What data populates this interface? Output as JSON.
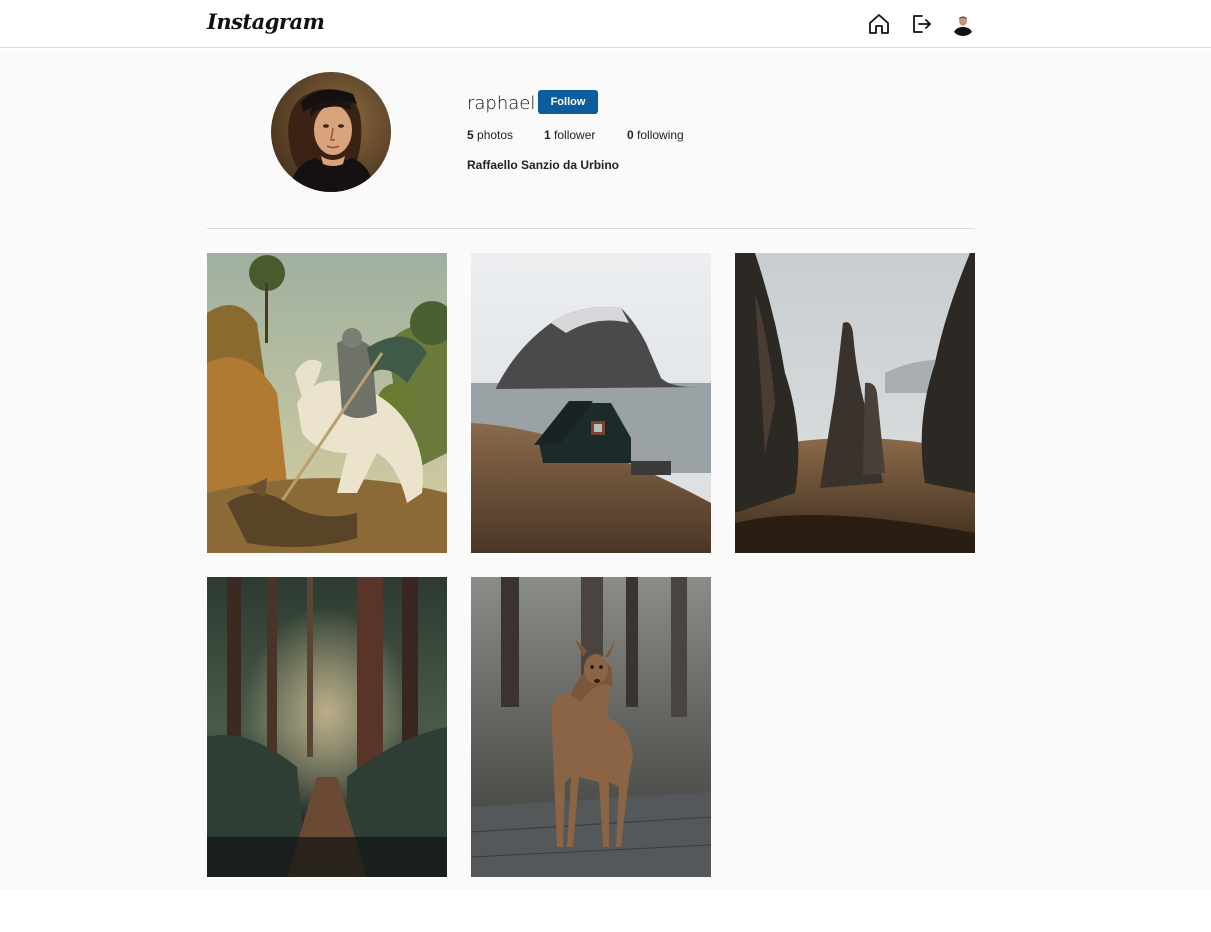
{
  "header": {
    "logo": "Instagram",
    "icons": [
      "home-icon",
      "logout-icon",
      "user-avatar"
    ]
  },
  "profile": {
    "username": "raphael",
    "follow_label": "Follow",
    "photos_count": "5",
    "photos_label": "photos",
    "followers_count": "1",
    "followers_label": "follower",
    "following_count": "0",
    "following_label": "following",
    "full_name": "Raffaello Sanzio da Urbino"
  },
  "colors": {
    "follow_button": "#0b5d9b",
    "page_background": "#fafafa",
    "divider": "#dbdbdb"
  },
  "photos": [
    {
      "subject": "painting-knight-dragon"
    },
    {
      "subject": "cabin-island-fog"
    },
    {
      "subject": "rock-spires-landscape"
    },
    {
      "subject": "forest-path"
    },
    {
      "subject": "deer"
    }
  ]
}
